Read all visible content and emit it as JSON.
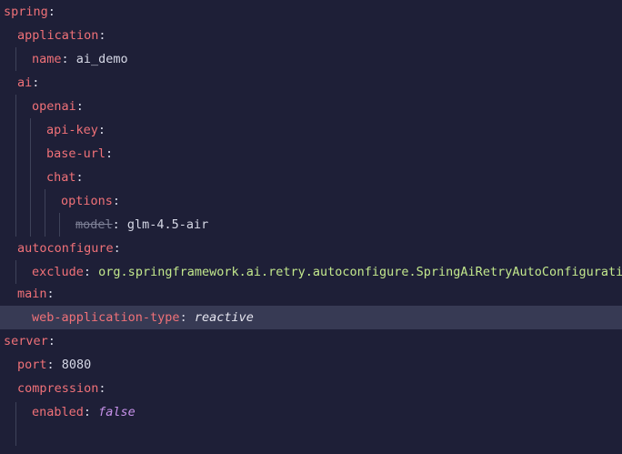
{
  "editor": {
    "lines": [
      {
        "key": "spring",
        "colon": ":"
      },
      {
        "key": "application",
        "colon": ":"
      },
      {
        "key": "name",
        "colon": ":",
        "value": " ai_demo"
      },
      {
        "key": "ai",
        "colon": ":"
      },
      {
        "key": "openai",
        "colon": ":"
      },
      {
        "key": "api-key",
        "colon": ":"
      },
      {
        "key": "base-url",
        "colon": ":"
      },
      {
        "key": "chat",
        "colon": ":"
      },
      {
        "key": "options",
        "colon": ":"
      },
      {
        "key": "model",
        "colon": ":",
        "value": " glm-4.5-air"
      },
      {
        "key": "autoconfigure",
        "colon": ":"
      },
      {
        "key": "exclude",
        "colon": ":",
        "value": " org.springframework.ai.retry.autoconfigure.SpringAiRetryAutoConfiguration"
      },
      {
        "key": "main",
        "colon": ":"
      },
      {
        "key": "web-application-type",
        "colon": ":",
        "value": " reactive"
      },
      {
        "key": "server",
        "colon": ":"
      },
      {
        "key": "port",
        "colon": ":",
        "value": " 8080"
      },
      {
        "key": "compression",
        "colon": ":"
      },
      {
        "key": "enabled",
        "colon": ":",
        "value": " false"
      }
    ]
  },
  "colors": {
    "background": "#1e1f37",
    "key": "#f07178",
    "highlight_line": "#373a54",
    "class_value": "#c3e88d",
    "keyword_value": "#c792ea"
  }
}
